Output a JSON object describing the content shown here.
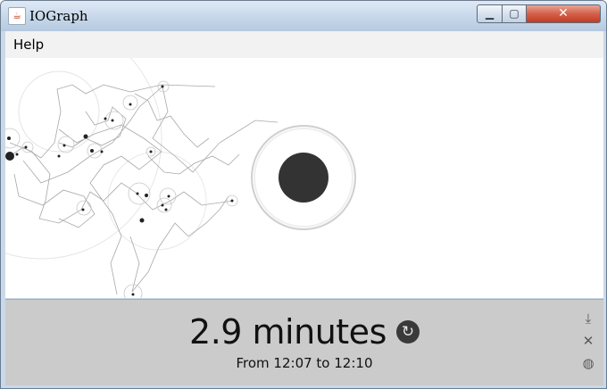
{
  "window": {
    "title": "IOGraph",
    "icon": "java-cup-icon",
    "controls": {
      "minimize_icon": "minimize-icon",
      "maximize_icon": "maximize-icon",
      "close_icon": "close-icon"
    }
  },
  "menu": {
    "items": [
      {
        "label": "Help"
      }
    ]
  },
  "status": {
    "duration": "2.9 minutes",
    "range": "From 12:07 to 12:10",
    "refresh_icon": "refresh-icon"
  },
  "side_tools": [
    {
      "icon": "save-icon"
    },
    {
      "icon": "settings-icon"
    },
    {
      "icon": "globe-icon"
    }
  ],
  "colors": {
    "status_bg": "#cbcbcb",
    "canvas_bg": "#ffffff",
    "trail": "#9a9a9a",
    "dot": "#222222"
  }
}
